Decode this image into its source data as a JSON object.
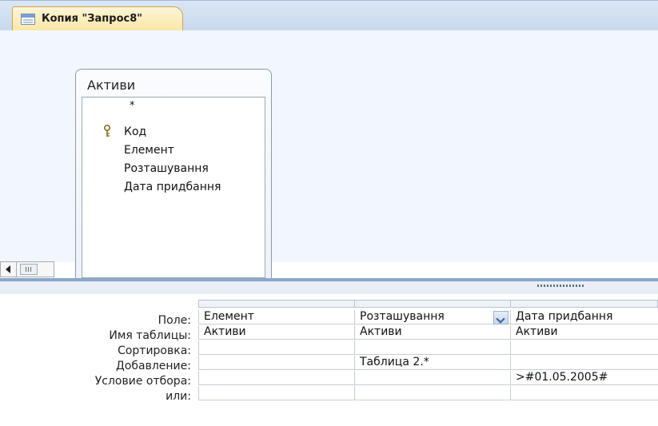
{
  "tab": {
    "label": "Копия \"Запрос8\"",
    "icon": "query-icon"
  },
  "table": {
    "title": "Активи",
    "fields": [
      "*",
      "Код",
      "Елемент",
      "Розташування",
      "Дата придбання"
    ],
    "key_field": "Код"
  },
  "grid": {
    "row_labels": [
      "Поле:",
      "Имя таблицы:",
      "Сортировка:",
      "Добавление:",
      "Условие отбора:",
      "или:"
    ],
    "columns": [
      {
        "field": "Елемент",
        "table": "Активи",
        "sort": "",
        "append": "",
        "criteria": "",
        "or": ""
      },
      {
        "field": "Розташування",
        "table": "Активи",
        "sort": "",
        "append": "Таблица 2.*",
        "criteria": "",
        "or": ""
      },
      {
        "field": "Дата придбання",
        "table": "Активи",
        "sort": "",
        "append": "",
        "criteria": ">#01.05.2005#",
        "or": ""
      }
    ]
  },
  "colors": {
    "tab_bg": "#fbe6a6",
    "surface": "#f2f7fd",
    "grid_line": "#c7ced8"
  }
}
